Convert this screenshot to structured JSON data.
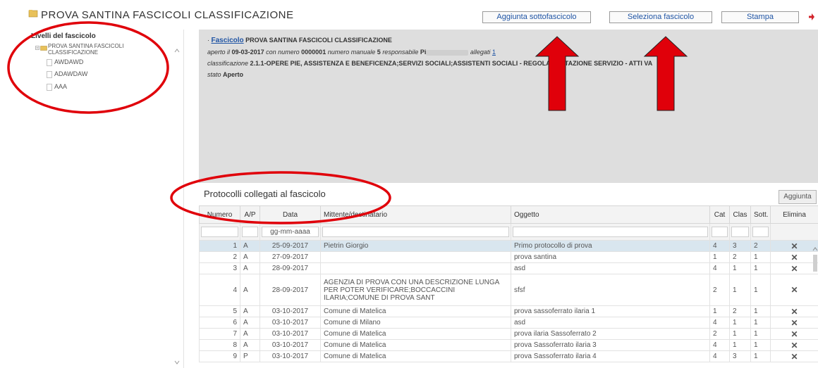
{
  "header": {
    "title": "PROVA SANTINA FASCICOLI CLASSIFICAZIONE",
    "buttons": {
      "add_subfolder": "Aggiunta sottofascicolo",
      "select_folder": "Seleziona fascicolo",
      "print": "Stampa"
    }
  },
  "left_panel": {
    "title": "Livelli del fascicolo",
    "root": "PROVA SANTINA FASCICOLI CLASSIFICAZIONE",
    "items": [
      "AWDAWD",
      "ADAWDAW",
      "AAA"
    ]
  },
  "detail": {
    "link_label": "Fascicolo",
    "name": "PROVA SANTINA FASCICOLI CLASSIFICAZIONE",
    "opened_label": "aperto il",
    "opened_date": "09-03-2017",
    "number_label": "con numero",
    "number": "0000001",
    "manual_label": "numero manuale",
    "manual": "5",
    "responsible_label": "responsabile",
    "responsible": "Pi",
    "attachments_label": "allegati",
    "attachments": "1",
    "classification_label": "classificazione",
    "classification": "2.1.1-OPERE PIE, ASSISTENZA E BENEFICENZA;SERVIZI SOCIALI;ASSISTENTI SOCIALI - REGOLAMENTAZIONE SERVIZIO - ATTI VA",
    "state_label": "stato",
    "state": "Aperto"
  },
  "protocols": {
    "title": "Protocolli collegati al fascicolo",
    "add_button": "Aggiunta",
    "columns": [
      "Numero",
      "A/P",
      "Data",
      "Mittente/destinatario",
      "Oggetto",
      "Cat",
      "Clas",
      "Sott.",
      "Elimina"
    ],
    "date_filter_placeholder": "gg-mm-aaaa",
    "rows": [
      {
        "numero": "1",
        "ap": "A",
        "data": "25-09-2017",
        "mittente": "Pietrin Giorgio",
        "oggetto": "Primo protocollo di prova",
        "cat": "4",
        "clas": "3",
        "sott": "2"
      },
      {
        "numero": "2",
        "ap": "A",
        "data": "27-09-2017",
        "mittente": "",
        "oggetto": "prova santina",
        "cat": "1",
        "clas": "2",
        "sott": "1"
      },
      {
        "numero": "3",
        "ap": "A",
        "data": "28-09-2017",
        "mittente": "",
        "oggetto": "asd",
        "cat": "4",
        "clas": "1",
        "sott": "1"
      },
      {
        "numero": "4",
        "ap": "A",
        "data": "28-09-2017",
        "mittente": "AGENZIA DI PROVA CON UNA DESCRIZIONE LUNGA PER POTER VERIFICARE;BOCCACCINI ILARIA;COMUNE DI PROVA SANT",
        "oggetto": "sfsf",
        "cat": "2",
        "clas": "1",
        "sott": "1"
      },
      {
        "numero": "5",
        "ap": "A",
        "data": "03-10-2017",
        "mittente": "Comune di Matelica",
        "oggetto": "prova sassoferrato ilaria 1",
        "cat": "1",
        "clas": "2",
        "sott": "1"
      },
      {
        "numero": "6",
        "ap": "A",
        "data": "03-10-2017",
        "mittente": "Comune di Milano",
        "oggetto": "asd",
        "cat": "4",
        "clas": "1",
        "sott": "1"
      },
      {
        "numero": "7",
        "ap": "A",
        "data": "03-10-2017",
        "mittente": "Comune di Matelica",
        "oggetto": "prova ilaria Sassoferrato 2",
        "cat": "2",
        "clas": "1",
        "sott": "1"
      },
      {
        "numero": "8",
        "ap": "A",
        "data": "03-10-2017",
        "mittente": "Comune di Matelica",
        "oggetto": "prova Sassoferrato ilaria 3",
        "cat": "4",
        "clas": "1",
        "sott": "1"
      },
      {
        "numero": "9",
        "ap": "P",
        "data": "03-10-2017",
        "mittente": "Comune di Matelica",
        "oggetto": "prova Sassoferrato ilaria 4",
        "cat": "4",
        "clas": "3",
        "sott": "1"
      }
    ]
  },
  "colors": {
    "link": "#1f54a4",
    "delete": "#c0141a",
    "annotation_red": "#e0000a",
    "selected_row": "#d9e6ef",
    "panel_gray": "#dedede"
  }
}
